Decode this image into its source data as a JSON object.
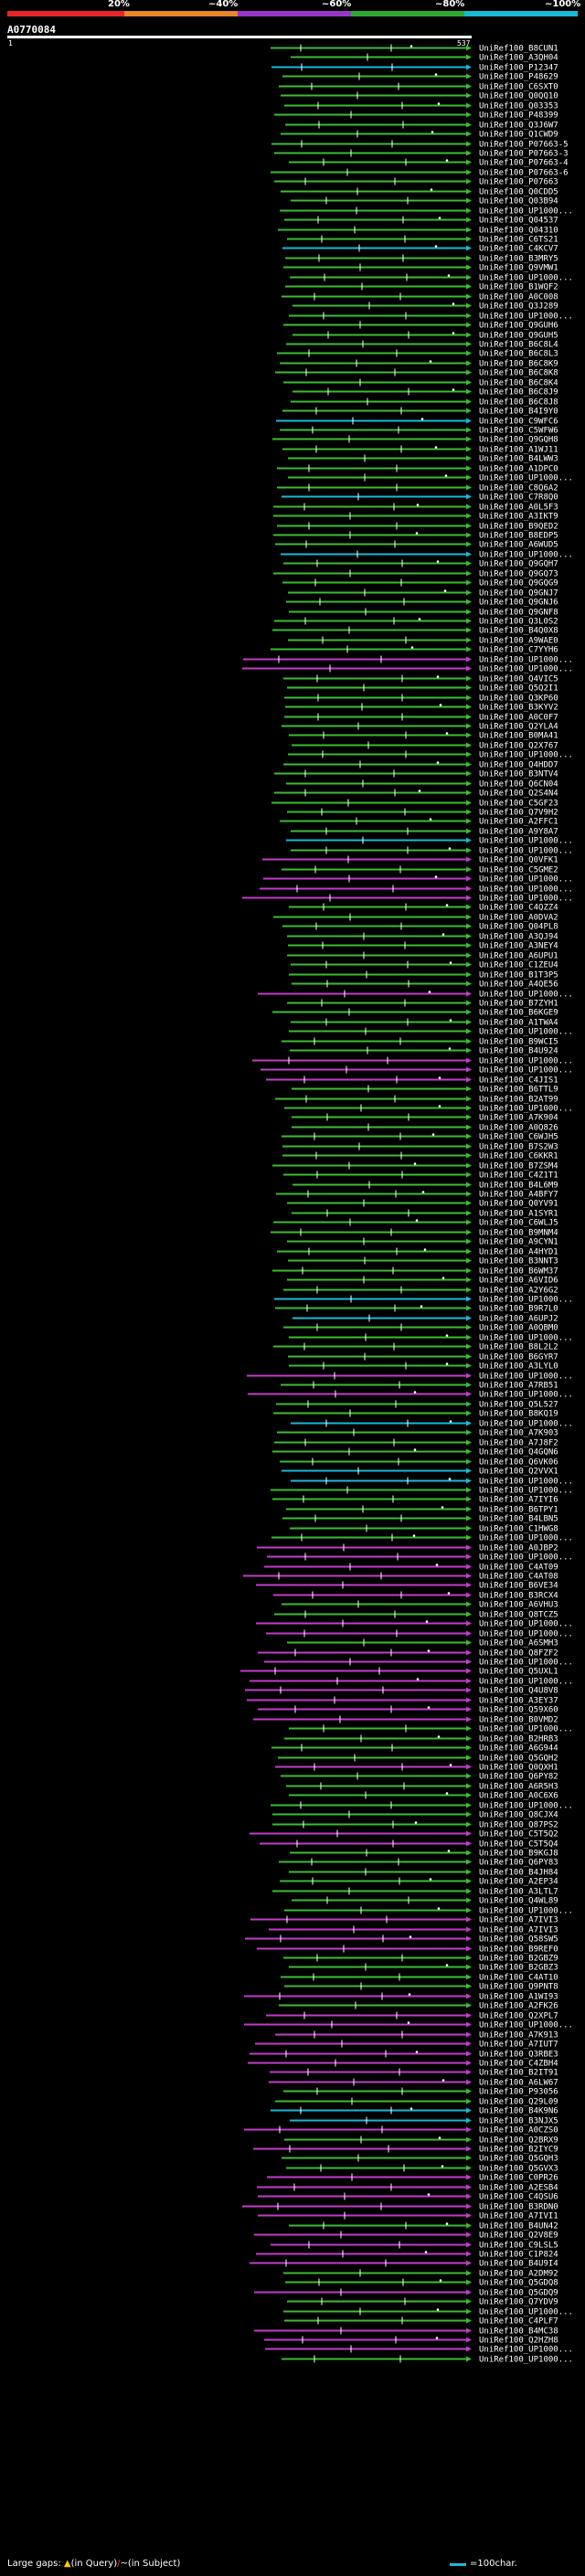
{
  "legend": {
    "labels": [
      "20%",
      "~40%",
      "~60%",
      "~80%",
      "~100%"
    ],
    "colors": [
      "#e8252a",
      "#e8862a",
      "#9b36c8",
      "#2fa82f",
      "#19b9d6"
    ]
  },
  "query": {
    "name": "A0770084",
    "start": "1",
    "end": "537"
  },
  "hit_colors": {
    "green": "#3dbb32",
    "magenta": "#c23cc8",
    "cyan": "#19b9d6",
    "tick": "#ffffff",
    "dot": "#ffffff"
  },
  "hits": [
    {
      "id": "UniRef100_B8CUN1",
      "color": "green"
    },
    {
      "id": "UniRef100_A3QH04",
      "color": "green"
    },
    {
      "id": "UniRef100_P12347",
      "color": "cyan"
    },
    {
      "id": "UniRef100_P48629",
      "color": "green"
    },
    {
      "id": "UniRef100_C6SXT0",
      "color": "green"
    },
    {
      "id": "UniRef100_Q0QQ10",
      "color": "green"
    },
    {
      "id": "UniRef100_Q03353",
      "color": "green"
    },
    {
      "id": "UniRef100_P48399",
      "color": "green"
    },
    {
      "id": "UniRef100_Q3J6W7",
      "color": "green"
    },
    {
      "id": "UniRef100_Q1CWD9",
      "color": "green"
    },
    {
      "id": "UniRef100_P07663-5",
      "color": "green"
    },
    {
      "id": "UniRef100_P07663-3",
      "color": "green"
    },
    {
      "id": "UniRef100_P07663-4",
      "color": "green"
    },
    {
      "id": "UniRef100_P07663-6",
      "color": "green"
    },
    {
      "id": "UniRef100_P07663",
      "color": "green"
    },
    {
      "id": "UniRef100_Q0CDD5",
      "color": "green"
    },
    {
      "id": "UniRef100_Q03B94",
      "color": "green"
    },
    {
      "id": "UniRef100_UP1000...",
      "color": "green"
    },
    {
      "id": "UniRef100_Q04537",
      "color": "green"
    },
    {
      "id": "UniRef100_Q04310",
      "color": "green"
    },
    {
      "id": "UniRef100_C6TS21",
      "color": "green"
    },
    {
      "id": "UniRef100_C4KCV7",
      "color": "cyan"
    },
    {
      "id": "UniRef100_B3MRY5",
      "color": "green"
    },
    {
      "id": "UniRef100_Q9VMW1",
      "color": "green"
    },
    {
      "id": "UniRef100_UP1000...",
      "color": "green"
    },
    {
      "id": "UniRef100_B1WQF2",
      "color": "green"
    },
    {
      "id": "UniRef100_A0C008",
      "color": "green"
    },
    {
      "id": "UniRef100_Q3J289",
      "color": "green"
    },
    {
      "id": "UniRef100_UP1000...",
      "color": "green"
    },
    {
      "id": "UniRef100_Q9GUH6",
      "color": "green"
    },
    {
      "id": "UniRef100_Q9GUH5",
      "color": "green"
    },
    {
      "id": "UniRef100_B6C8L4",
      "color": "green"
    },
    {
      "id": "UniRef100_B6C8L3",
      "color": "green"
    },
    {
      "id": "UniRef100_B6C8K9",
      "color": "green"
    },
    {
      "id": "UniRef100_B6C8K8",
      "color": "green"
    },
    {
      "id": "UniRef100_B6C8K4",
      "color": "green"
    },
    {
      "id": "UniRef100_B6C8J9",
      "color": "green"
    },
    {
      "id": "UniRef100_B6C8J8",
      "color": "green"
    },
    {
      "id": "UniRef100_B4I9Y0",
      "color": "green"
    },
    {
      "id": "UniRef100_C9WFC6",
      "color": "cyan"
    },
    {
      "id": "UniRef100_C5WFW6",
      "color": "green"
    },
    {
      "id": "UniRef100_Q9GQH8",
      "color": "green"
    },
    {
      "id": "UniRef100_A1WJ11",
      "color": "green"
    },
    {
      "id": "UniRef100_B4LWW3",
      "color": "green"
    },
    {
      "id": "UniRef100_A1DPC0",
      "color": "green"
    },
    {
      "id": "UniRef100_UP1000...",
      "color": "green"
    },
    {
      "id": "UniRef100_C8Q6A2",
      "color": "green"
    },
    {
      "id": "UniRef100_C7R8Q0",
      "color": "cyan"
    },
    {
      "id": "UniRef100_A0L5F3",
      "color": "green"
    },
    {
      "id": "UniRef100_A3IKT9",
      "color": "green"
    },
    {
      "id": "UniRef100_B9QED2",
      "color": "green"
    },
    {
      "id": "UniRef100_B8EDP5",
      "color": "green"
    },
    {
      "id": "UniRef100_A6WUD5",
      "color": "green"
    },
    {
      "id": "UniRef100_UP1000...",
      "color": "cyan"
    },
    {
      "id": "UniRef100_Q9GQH7",
      "color": "green"
    },
    {
      "id": "UniRef100_Q9GQ73",
      "color": "green"
    },
    {
      "id": "UniRef100_Q9GQG9",
      "color": "green"
    },
    {
      "id": "UniRef100_Q9GNJ7",
      "color": "green"
    },
    {
      "id": "UniRef100_Q9GNJ6",
      "color": "green"
    },
    {
      "id": "UniRef100_Q9GNF8",
      "color": "green"
    },
    {
      "id": "UniRef100_Q3L0S2",
      "color": "green"
    },
    {
      "id": "UniRef100_B4Q0X8",
      "color": "green"
    },
    {
      "id": "UniRef100_A9WAE0",
      "color": "green"
    },
    {
      "id": "UniRef100_C7YYH6",
      "color": "green"
    },
    {
      "id": "UniRef100_UP1000...",
      "color": "magenta"
    },
    {
      "id": "UniRef100_UP1000...",
      "color": "magenta"
    },
    {
      "id": "UniRef100_Q4VIC5",
      "color": "green"
    },
    {
      "id": "UniRef100_Q5Q2I1",
      "color": "green"
    },
    {
      "id": "UniRef100_Q3KP60",
      "color": "green"
    },
    {
      "id": "UniRef100_B3KYV2",
      "color": "green"
    },
    {
      "id": "UniRef100_A0C0F7",
      "color": "green"
    },
    {
      "id": "UniRef100_Q2YLA4",
      "color": "green"
    },
    {
      "id": "UniRef100_B0MA41",
      "color": "green"
    },
    {
      "id": "UniRef100_Q2X767",
      "color": "green"
    },
    {
      "id": "UniRef100_UP1000...",
      "color": "green"
    },
    {
      "id": "UniRef100_Q4HDD7",
      "color": "green"
    },
    {
      "id": "UniRef100_B3NTV4",
      "color": "green"
    },
    {
      "id": "UniRef100_Q6CN04",
      "color": "green"
    },
    {
      "id": "UniRef100_Q2S4N4",
      "color": "green"
    },
    {
      "id": "UniRef100_C5GF23",
      "color": "green"
    },
    {
      "id": "UniRef100_Q7V9H2",
      "color": "green"
    },
    {
      "id": "UniRef100_A2FFC1",
      "color": "green"
    },
    {
      "id": "UniRef100_A9Y8A7",
      "color": "green"
    },
    {
      "id": "UniRef100_UP1000...",
      "color": "cyan"
    },
    {
      "id": "UniRef100_UP1000...",
      "color": "green"
    },
    {
      "id": "UniRef100_Q0VFK1",
      "color": "magenta"
    },
    {
      "id": "UniRef100_C5GME2",
      "color": "green"
    },
    {
      "id": "UniRef100_UP1000...",
      "color": "magenta"
    },
    {
      "id": "UniRef100_UP1000...",
      "color": "magenta"
    },
    {
      "id": "UniRef100_UP1000...",
      "color": "magenta"
    },
    {
      "id": "UniRef100_C4QZZ4",
      "color": "green"
    },
    {
      "id": "UniRef100_A0DVA2",
      "color": "green"
    },
    {
      "id": "UniRef100_Q04PL8",
      "color": "green"
    },
    {
      "id": "UniRef100_A3QJ94",
      "color": "green"
    },
    {
      "id": "UniRef100_A3NEY4",
      "color": "green"
    },
    {
      "id": "UniRef100_A6UPU1",
      "color": "green"
    },
    {
      "id": "UniRef100_C1ZEU4",
      "color": "green"
    },
    {
      "id": "UniRef100_B1T3P5",
      "color": "green"
    },
    {
      "id": "UniRef100_A4QE56",
      "color": "green"
    },
    {
      "id": "UniRef100_UP1000...",
      "color": "magenta"
    },
    {
      "id": "UniRef100_B7ZYH1",
      "color": "green"
    },
    {
      "id": "UniRef100_B6KGE9",
      "color": "green"
    },
    {
      "id": "UniRef100_A1TWA4",
      "color": "green"
    },
    {
      "id": "UniRef100_UP1000...",
      "color": "green"
    },
    {
      "id": "UniRef100_B9WCI5",
      "color": "green"
    },
    {
      "id": "UniRef100_B4U924",
      "color": "green"
    },
    {
      "id": "UniRef100_UP1000...",
      "color": "magenta"
    },
    {
      "id": "UniRef100_UP1000...",
      "color": "magenta"
    },
    {
      "id": "UniRef100_C4JIS1",
      "color": "magenta"
    },
    {
      "id": "UniRef100_B6TTL9",
      "color": "green"
    },
    {
      "id": "UniRef100_B2AT99",
      "color": "green"
    },
    {
      "id": "UniRef100_UP1000...",
      "color": "green"
    },
    {
      "id": "UniRef100_A7K904",
      "color": "green"
    },
    {
      "id": "UniRef100_A0Q826",
      "color": "green"
    },
    {
      "id": "UniRef100_C6WJH5",
      "color": "green"
    },
    {
      "id": "UniRef100_B7S2W3",
      "color": "green"
    },
    {
      "id": "UniRef100_C6KKR1",
      "color": "green"
    },
    {
      "id": "UniRef100_B7ZSM4",
      "color": "green"
    },
    {
      "id": "UniRef100_C4Z1T1",
      "color": "green"
    },
    {
      "id": "UniRef100_B4L6M9",
      "color": "green"
    },
    {
      "id": "UniRef100_A4BFY7",
      "color": "green"
    },
    {
      "id": "UniRef100_Q0YV91",
      "color": "green"
    },
    {
      "id": "UniRef100_A1SYR1",
      "color": "green"
    },
    {
      "id": "UniRef100_C6WLJ5",
      "color": "green"
    },
    {
      "id": "UniRef100_B9MNM4",
      "color": "green"
    },
    {
      "id": "UniRef100_A9CYN1",
      "color": "green"
    },
    {
      "id": "UniRef100_A4HYD1",
      "color": "green"
    },
    {
      "id": "UniRef100_B3NNT3",
      "color": "green"
    },
    {
      "id": "UniRef100_B6WM37",
      "color": "green"
    },
    {
      "id": "UniRef100_A6VID6",
      "color": "green"
    },
    {
      "id": "UniRef100_A2Y6G2",
      "color": "green"
    },
    {
      "id": "UniRef100_UP1000...",
      "color": "cyan"
    },
    {
      "id": "UniRef100_B9R7L0",
      "color": "green"
    },
    {
      "id": "UniRef100_A6UPJ2",
      "color": "cyan"
    },
    {
      "id": "UniRef100_A0QBM0",
      "color": "green"
    },
    {
      "id": "UniRef100_UP1000...",
      "color": "green"
    },
    {
      "id": "UniRef100_B8L2L2",
      "color": "green"
    },
    {
      "id": "UniRef100_B6GYR7",
      "color": "green"
    },
    {
      "id": "UniRef100_A3LYL0",
      "color": "green"
    },
    {
      "id": "UniRef100_UP1000...",
      "color": "magenta"
    },
    {
      "id": "UniRef100_A7RB51",
      "color": "green"
    },
    {
      "id": "UniRef100_UP1000...",
      "color": "magenta"
    },
    {
      "id": "UniRef100_Q5L527",
      "color": "green"
    },
    {
      "id": "UniRef100_B8KQ19",
      "color": "green"
    },
    {
      "id": "UniRef100_UP1000...",
      "color": "cyan"
    },
    {
      "id": "UniRef100_A7K903",
      "color": "green"
    },
    {
      "id": "UniRef100_A7J8F2",
      "color": "green"
    },
    {
      "id": "UniRef100_Q4GQN6",
      "color": "green"
    },
    {
      "id": "UniRef100_Q6VK06",
      "color": "green"
    },
    {
      "id": "UniRef100_Q2VVX1",
      "color": "cyan"
    },
    {
      "id": "UniRef100_UP1000...",
      "color": "cyan"
    },
    {
      "id": "UniRef100_UP1000...",
      "color": "green"
    },
    {
      "id": "UniRef100_A7IYI6",
      "color": "green"
    },
    {
      "id": "UniRef100_B6TPY1",
      "color": "green"
    },
    {
      "id": "UniRef100_B4LBN5",
      "color": "green"
    },
    {
      "id": "UniRef100_C1HWG8",
      "color": "green"
    },
    {
      "id": "UniRef100_UP1000...",
      "color": "green"
    },
    {
      "id": "UniRef100_A0JBP2",
      "color": "magenta"
    },
    {
      "id": "UniRef100_UP1000...",
      "color": "magenta"
    },
    {
      "id": "UniRef100_C4AT09",
      "color": "magenta"
    },
    {
      "id": "UniRef100_C4AT08",
      "color": "magenta"
    },
    {
      "id": "UniRef100_B6VE34",
      "color": "magenta"
    },
    {
      "id": "UniRef100_B3RCX4",
      "color": "magenta"
    },
    {
      "id": "UniRef100_A6VHU3",
      "color": "green"
    },
    {
      "id": "UniRef100_Q8TCZ5",
      "color": "green"
    },
    {
      "id": "UniRef100_UP1000...",
      "color": "magenta"
    },
    {
      "id": "UniRef100_UP1000...",
      "color": "magenta"
    },
    {
      "id": "UniRef100_A6SMH3",
      "color": "green"
    },
    {
      "id": "UniRef100_Q8FZF2",
      "color": "magenta"
    },
    {
      "id": "UniRef100_UP1000...",
      "color": "magenta"
    },
    {
      "id": "UniRef100_Q5UXL1",
      "color": "magenta"
    },
    {
      "id": "UniRef100_UP1000...",
      "color": "magenta"
    },
    {
      "id": "UniRef100_Q4U8V8",
      "color": "magenta"
    },
    {
      "id": "UniRef100_A3EY37",
      "color": "magenta"
    },
    {
      "id": "UniRef100_Q59X60",
      "color": "magenta"
    },
    {
      "id": "UniRef100_B0VMD2",
      "color": "magenta"
    },
    {
      "id": "UniRef100_UP1000...",
      "color": "green"
    },
    {
      "id": "UniRef100_B2HRB3",
      "color": "green"
    },
    {
      "id": "UniRef100_A6G944",
      "color": "green"
    },
    {
      "id": "UniRef100_Q5GQH2",
      "color": "green"
    },
    {
      "id": "UniRef100_Q0QXH1",
      "color": "magenta"
    },
    {
      "id": "UniRef100_Q6PY82",
      "color": "green"
    },
    {
      "id": "UniRef100_A6R5H3",
      "color": "green"
    },
    {
      "id": "UniRef100_A0C6X6",
      "color": "green"
    },
    {
      "id": "UniRef100_UP1000...",
      "color": "green"
    },
    {
      "id": "UniRef100_Q8CJX4",
      "color": "green"
    },
    {
      "id": "UniRef100_Q87PS2",
      "color": "green"
    },
    {
      "id": "UniRef100_C5T5Q2",
      "color": "magenta"
    },
    {
      "id": "UniRef100_C5T5Q4",
      "color": "magenta"
    },
    {
      "id": "UniRef100_B9KGJ8",
      "color": "green"
    },
    {
      "id": "UniRef100_Q6PY83",
      "color": "green"
    },
    {
      "id": "UniRef100_B4JH84",
      "color": "green"
    },
    {
      "id": "UniRef100_A2EP34",
      "color": "green"
    },
    {
      "id": "UniRef100_A3LTL7",
      "color": "green"
    },
    {
      "id": "UniRef100_Q4WL89",
      "color": "green"
    },
    {
      "id": "UniRef100_UP1000...",
      "color": "green"
    },
    {
      "id": "UniRef100_A7IVI3",
      "color": "magenta"
    },
    {
      "id": "UniRef100_A7IVI3",
      "color": "magenta"
    },
    {
      "id": "UniRef100_Q58SW5",
      "color": "magenta"
    },
    {
      "id": "UniRef100_B9REF0",
      "color": "magenta"
    },
    {
      "id": "UniRef100_B2GBZ9",
      "color": "green"
    },
    {
      "id": "UniRef100_B2GBZ3",
      "color": "green"
    },
    {
      "id": "UniRef100_C4AT10",
      "color": "green"
    },
    {
      "id": "UniRef100_Q9PNT8",
      "color": "green"
    },
    {
      "id": "UniRef100_A1WI93",
      "color": "magenta"
    },
    {
      "id": "UniRef100_A2FK26",
      "color": "green"
    },
    {
      "id": "UniRef100_Q2XPL7",
      "color": "magenta"
    },
    {
      "id": "UniRef100_UP1000...",
      "color": "magenta"
    },
    {
      "id": "UniRef100_A7K913",
      "color": "magenta"
    },
    {
      "id": "UniRef100_A7IUT7",
      "color": "magenta"
    },
    {
      "id": "UniRef100_Q3RBE3",
      "color": "magenta"
    },
    {
      "id": "UniRef100_C4ZBH4",
      "color": "magenta"
    },
    {
      "id": "UniRef100_B2IT91",
      "color": "magenta"
    },
    {
      "id": "UniRef100_A6LW67",
      "color": "magenta"
    },
    {
      "id": "UniRef100_P93056",
      "color": "green"
    },
    {
      "id": "UniRef100_Q29L09",
      "color": "green"
    },
    {
      "id": "UniRef100_B4K9N6",
      "color": "cyan"
    },
    {
      "id": "UniRef100_B3NJX5",
      "color": "cyan"
    },
    {
      "id": "UniRef100_A0CZS0",
      "color": "magenta"
    },
    {
      "id": "UniRef100_Q2BRX9",
      "color": "green"
    },
    {
      "id": "UniRef100_B2IYC9",
      "color": "magenta"
    },
    {
      "id": "UniRef100_Q5GQH3",
      "color": "green"
    },
    {
      "id": "UniRef100_Q5GVX3",
      "color": "green"
    },
    {
      "id": "UniRef100_C0PR26",
      "color": "magenta"
    },
    {
      "id": "UniRef100_A2ESB4",
      "color": "magenta"
    },
    {
      "id": "UniRef100_C4QSU6",
      "color": "magenta"
    },
    {
      "id": "UniRef100_B3RDN0",
      "color": "magenta"
    },
    {
      "id": "UniRef100_A7IVI1",
      "color": "magenta"
    },
    {
      "id": "UniRef100_B4UN42",
      "color": "green"
    },
    {
      "id": "UniRef100_Q2V8E9",
      "color": "magenta"
    },
    {
      "id": "UniRef100_C9LSL5",
      "color": "magenta"
    },
    {
      "id": "UniRef100_C1P824",
      "color": "magenta"
    },
    {
      "id": "UniRef100_B4U9I4",
      "color": "magenta"
    },
    {
      "id": "UniRef100_A2DM92",
      "color": "green"
    },
    {
      "id": "UniRef100_Q5GDQ8",
      "color": "green"
    },
    {
      "id": "UniRef100_Q5GDQ9",
      "color": "magenta"
    },
    {
      "id": "UniRef100_Q7YDV9",
      "color": "green"
    },
    {
      "id": "UniRef100_UP1000...",
      "color": "green"
    },
    {
      "id": "UniRef100_C4PLF7",
      "color": "green"
    },
    {
      "id": "UniRef100_B4MC38",
      "color": "magenta"
    },
    {
      "id": "UniRef100_Q2HZH8",
      "color": "magenta"
    },
    {
      "id": "UniRef100_UP1000...",
      "color": "magenta"
    },
    {
      "id": "UniRef100_UP1000...",
      "color": "green"
    }
  ],
  "footer": {
    "gaps_prefix": "Large gaps: ",
    "query_glyph": "▲",
    "query_text": "(in Query)",
    "subject_glyph": "/",
    "subject_text": "~(in Subject)",
    "scale_label": "=100char."
  }
}
